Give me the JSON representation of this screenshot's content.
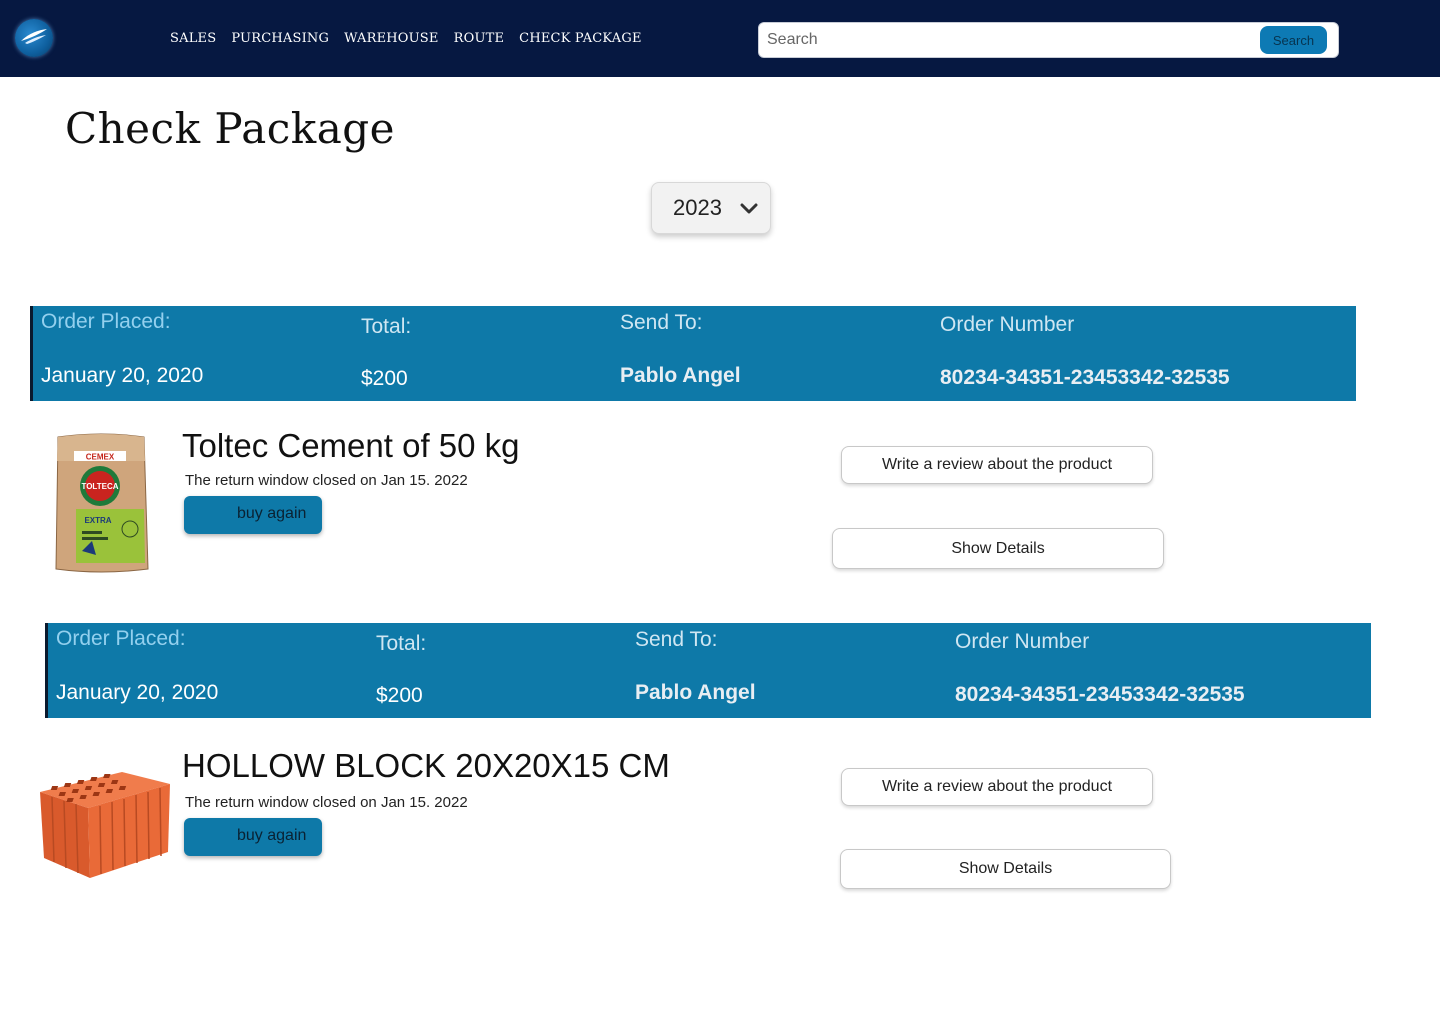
{
  "nav": {
    "items": [
      "SALES",
      "PURCHASING",
      "WAREHOUSE",
      "ROUTE",
      "CHECK PACKAGE"
    ],
    "search_placeholder": "Search",
    "search_button": "Search"
  },
  "page": {
    "title": "Check Package",
    "year": "2023"
  },
  "order_header_labels": {
    "placed": "Order Placed:",
    "total": "Total:",
    "send_to": "Send To:",
    "order_number": "Order Number"
  },
  "orders": [
    {
      "date": "January 20, 2020",
      "total": "$200",
      "send_to": "Pablo Angel",
      "order_number": "80234-34351-23453342-32535",
      "product_name": "Toltec Cement of 50 kg",
      "return_note": "The return window closed on Jan 15. 2022",
      "buy_again": "buy again",
      "review_button": "Write a review about the product",
      "details_button": "Show Details",
      "bag_brand": "CEMEX",
      "bag_logo": "TOLTECA",
      "bag_variant": "EXTRA"
    },
    {
      "date": "January 20, 2020",
      "total": "$200",
      "send_to": "Pablo Angel",
      "order_number": "80234-34351-23453342-32535",
      "product_name": "HOLLOW BLOCK 20X20X15 CM",
      "return_note": "The return window closed on Jan 15. 2022",
      "buy_again": "buy again",
      "review_button": "Write a review about the product",
      "details_button": "Show Details"
    }
  ],
  "colors": {
    "navbar": "#061841",
    "accent": "#0e79a8"
  }
}
